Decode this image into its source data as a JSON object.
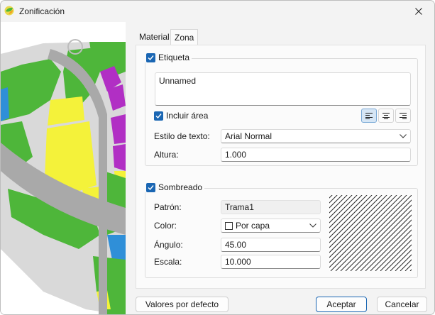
{
  "window": {
    "title": "Zonificación"
  },
  "tabs": [
    {
      "label": "Material",
      "active": false
    },
    {
      "label": "Zona",
      "active": true
    }
  ],
  "label_group": {
    "title": "Etiqueta",
    "checked": true,
    "text_value": "Unnamed",
    "include_area_label": "Incluir área",
    "include_area_checked": true,
    "alignment": "left",
    "text_style_label": "Estilo de texto:",
    "text_style_value": "Arial Normal",
    "height_label": "Altura:",
    "height_value": "1.000"
  },
  "hatch_group": {
    "title": "Sombreado",
    "checked": true,
    "pattern_label": "Patrón:",
    "pattern_value": "Trama1",
    "color_label": "Color:",
    "color_value": "Por capa",
    "angle_label": "Ángulo:",
    "angle_value": "45.00",
    "scale_label": "Escala:",
    "scale_value": "10.000"
  },
  "footer": {
    "defaults_label": "Valores por defecto",
    "accept_label": "Aceptar",
    "cancel_label": "Cancelar"
  },
  "colors": {
    "accent": "#1a66b3",
    "zone_green": "#4eb63a",
    "zone_yellow": "#f4f23a",
    "zone_purple": "#b12fc4",
    "road_gray": "#a9a9a9"
  },
  "icons": {
    "app": "zoning-app-icon",
    "close": "close-icon",
    "check": "check-icon",
    "chevron": "chevron-down-icon",
    "align_left": "align-left-icon",
    "align_center": "align-center-icon",
    "align_right": "align-right-icon"
  }
}
